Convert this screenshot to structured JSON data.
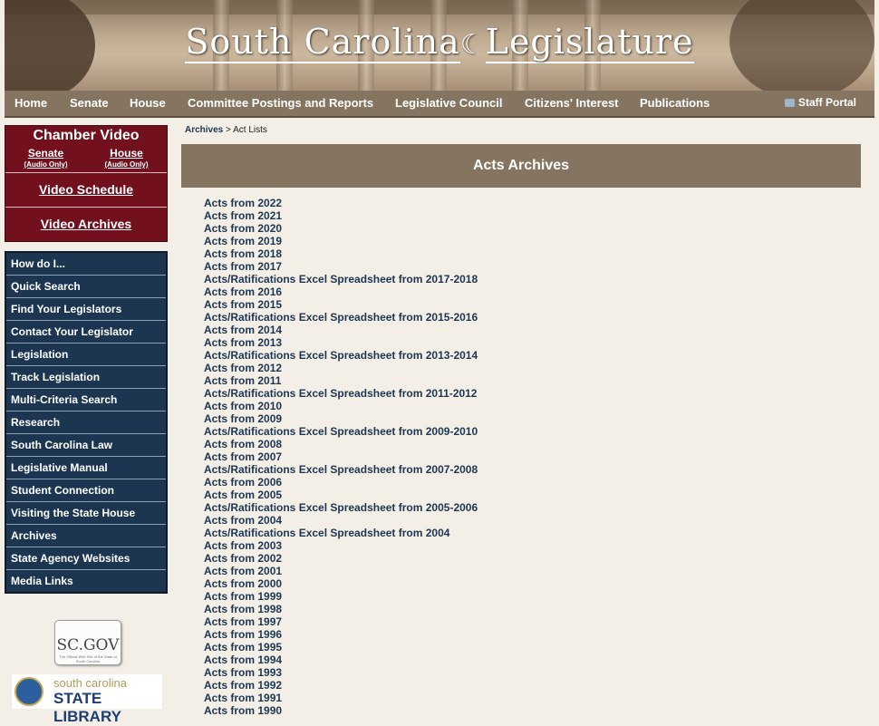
{
  "header": {
    "title_part1": "South Carolina",
    "title_part2": "Legislature"
  },
  "nav": {
    "items": [
      "Home",
      "Senate",
      "House",
      "Committee Postings and Reports",
      "Legislative Council",
      "Citizens' Interest",
      "Publications"
    ],
    "staff_portal": "Staff Portal"
  },
  "video": {
    "title": "Chamber Video",
    "senate": "Senate",
    "senate_sub": "(Audio Only)",
    "house": "House",
    "house_sub": "(Audio Only)",
    "schedule": "Video Schedule",
    "archives": "Video Archives"
  },
  "sidenav": {
    "items": [
      "How do I...",
      "Quick Search",
      "Find Your Legislators",
      "Contact Your Legislator",
      "Legislation",
      "Track Legislation",
      "Multi-Criteria Search",
      "Research",
      "South Carolina Law",
      "Legislative Manual",
      "Student Connection",
      "Visiting the State House",
      "Archives",
      "State Agency Websites",
      "Media Links"
    ]
  },
  "logos": {
    "scgov": "SC.GOV",
    "scgov_tag": "The Official Web Site of the State of South Carolina",
    "library_line1": "south carolina",
    "library_line2": "STATE LIBRARY"
  },
  "breadcrumb": {
    "link": "Archives",
    "sep": " > ",
    "current": "Act Lists"
  },
  "main": {
    "heading": "Acts Archives",
    "acts": [
      "Acts from 2022",
      "Acts from 2021",
      "Acts from 2020",
      "Acts from 2019",
      "Acts from 2018",
      "Acts from 2017",
      "Acts/Ratifications Excel Spreadsheet from 2017-2018",
      "Acts from 2016",
      "Acts from 2015",
      "Acts/Ratifications Excel Spreadsheet from 2015-2016",
      "Acts from 2014",
      "Acts from 2013",
      "Acts/Ratifications Excel Spreadsheet from 2013-2014",
      "Acts from 2012",
      "Acts from 2011",
      "Acts/Ratifications Excel Spreadsheet from 2011-2012",
      "Acts from 2010",
      "Acts from 2009",
      "Acts/Ratifications Excel Spreadsheet from 2009-2010",
      "Acts from 2008",
      "Acts from 2007",
      "Acts/Ratifications Excel Spreadsheet from 2007-2008",
      "Acts from 2006",
      "Acts from 2005",
      "Acts/Ratifications Excel Spreadsheet from 2005-2006",
      "Acts from 2004",
      "Acts/Ratifications Excel Spreadsheet from 2004",
      "Acts from 2003",
      "Acts from 2002",
      "Acts from 2001",
      "Acts from 2000",
      "Acts from 1999",
      "Acts from 1998",
      "Acts from 1997",
      "Acts from 1996",
      "Acts from 1995",
      "Acts from 1994",
      "Acts from 1993",
      "Acts from 1992",
      "Acts from 1991",
      "Acts from 1990"
    ]
  }
}
